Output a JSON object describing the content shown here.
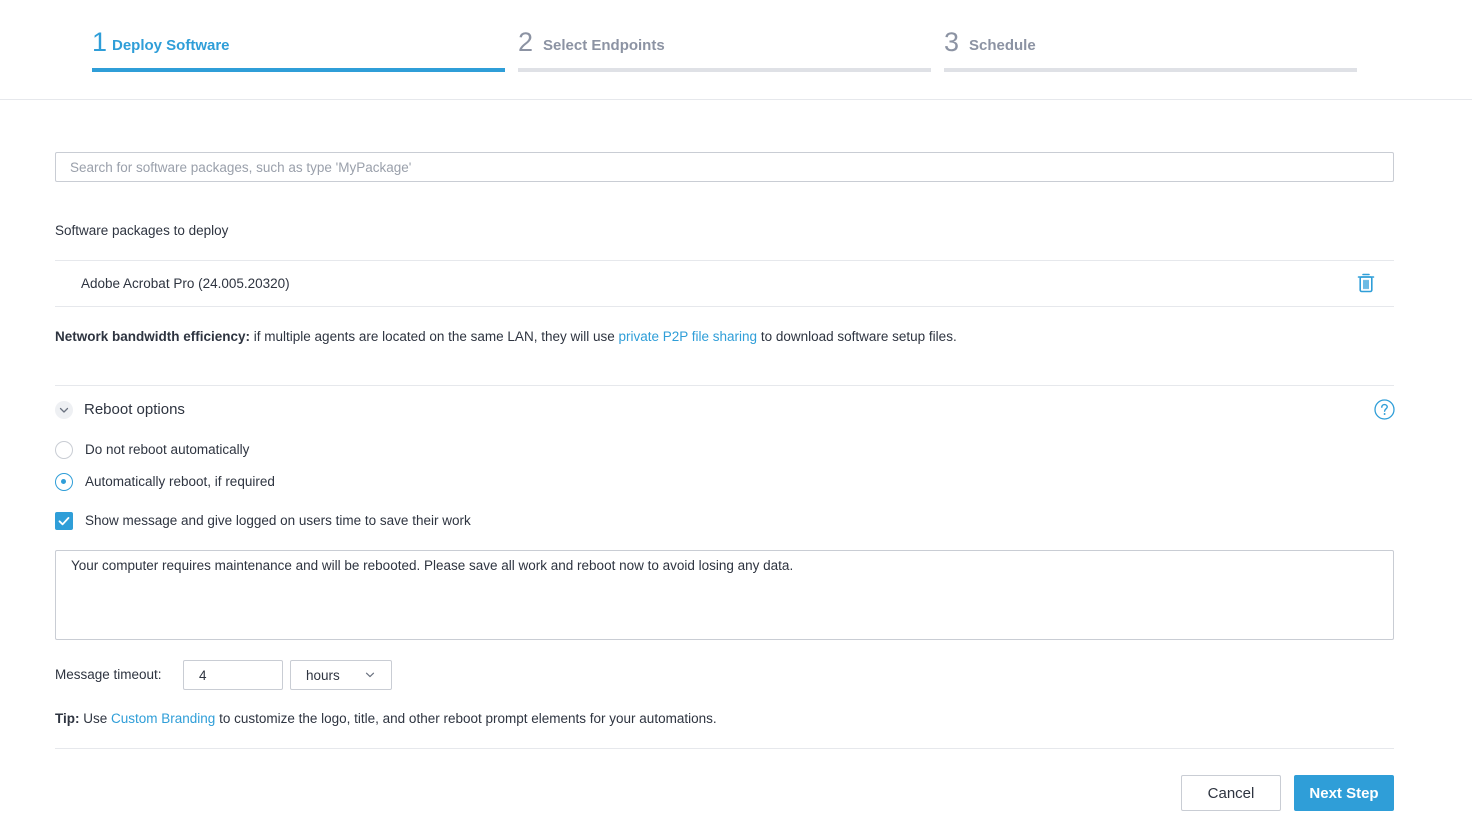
{
  "stepper": {
    "steps": [
      {
        "number": "1",
        "label": "Deploy Software",
        "state": "active"
      },
      {
        "number": "2",
        "label": "Select Endpoints",
        "state": "inactive"
      },
      {
        "number": "3",
        "label": "Schedule",
        "state": "inactive"
      }
    ]
  },
  "search": {
    "placeholder": "Search for software packages, such as type 'MyPackage'",
    "value": ""
  },
  "packages": {
    "label": "Software packages to deploy",
    "items": [
      {
        "name": "Adobe Acrobat Pro (24.005.20320)",
        "action_icon": "trash-icon"
      }
    ]
  },
  "bandwidth": {
    "bold": "Network bandwidth efficiency:",
    "text_before": " if multiple agents are located on the same LAN, they will use ",
    "link": "private P2P file sharing",
    "text_after": " to download software setup files."
  },
  "reboot": {
    "title": "Reboot options",
    "help_icon": "help-circle-icon",
    "options": [
      {
        "label": "Do not reboot automatically",
        "selected": false
      },
      {
        "label": "Automatically reboot, if required",
        "selected": true
      }
    ],
    "show_message": {
      "label": "Show message and give logged on users time to save their work",
      "checked": true
    },
    "message": "Your computer requires maintenance and will be rebooted. Please save all work and reboot now to avoid losing any data.",
    "timeout": {
      "label": "Message timeout:",
      "value": "4",
      "unit": "hours"
    }
  },
  "tip": {
    "bold": "Tip:",
    "text_before": " Use ",
    "link": "Custom Branding",
    "text_after": " to customize the logo, title, and other reboot prompt elements for your automations."
  },
  "footer": {
    "cancel_label": "Cancel",
    "next_label": "Next Step"
  },
  "colors": {
    "accent": "#2f9ed8",
    "inactive": "#8c93a3",
    "border": "#c9cdd4"
  }
}
